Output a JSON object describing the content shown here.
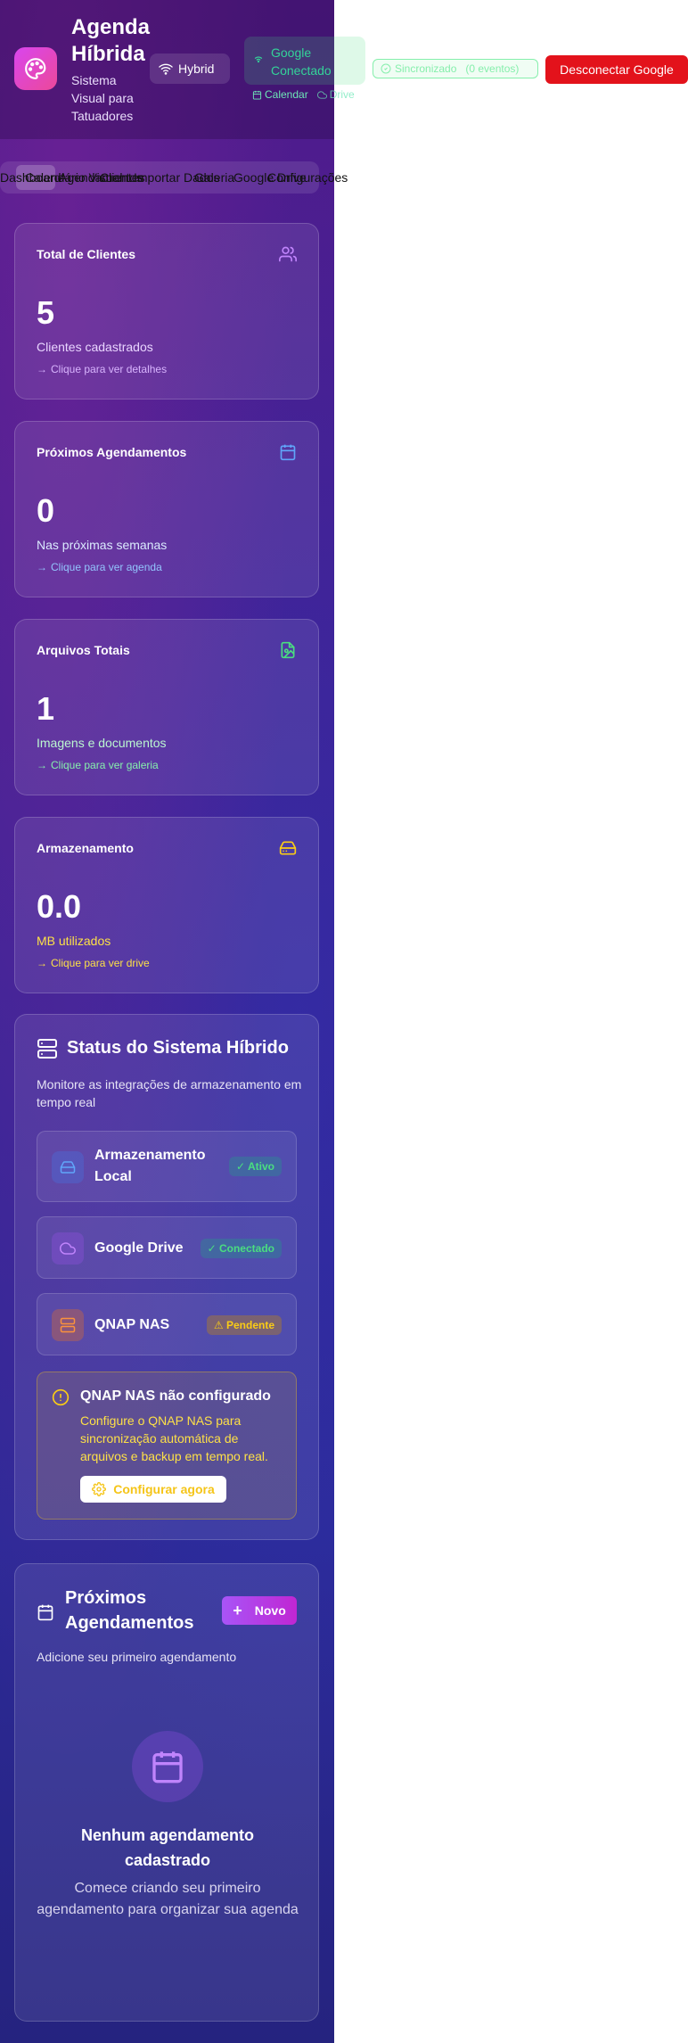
{
  "header": {
    "title": "Agenda Híbrida",
    "subtitle": "Sistema Visual para Tatuadores",
    "mode_label": "Hybrid",
    "google_status": "Google Conectado",
    "calendar_link": "Calendar",
    "drive_link": "Drive",
    "sync_status": "Sincronizado",
    "sync_events": "(0 eventos)",
    "disconnect_label": "Desconectar Google"
  },
  "tabs": [
    {
      "label": "Dashboard"
    },
    {
      "label": "Calendário Visual"
    },
    {
      "label": "Agendamentos"
    },
    {
      "label": "Clientes"
    },
    {
      "label": "Importar Dados"
    },
    {
      "label": "Galeria"
    },
    {
      "label": "Google Drive"
    },
    {
      "label": "Configurações"
    }
  ],
  "stats": [
    {
      "label": "Total de Clientes",
      "value": "5",
      "desc": "Clientes cadastrados",
      "link": "Clique para ver detalhes",
      "icon": "users-icon",
      "color": "#c084fc"
    },
    {
      "label": "Próximos Agendamentos",
      "value": "0",
      "desc": "Nas próximas semanas",
      "link": "Clique para ver agenda",
      "icon": "calendar-icon",
      "color": "#60a5fa"
    },
    {
      "label": "Arquivos Totais",
      "value": "1",
      "desc": "Imagens e documentos",
      "link": "Clique para ver galeria",
      "icon": "file-image-icon",
      "color": "#4ade80"
    },
    {
      "label": "Armazenamento",
      "value": "0.0",
      "desc": "MB utilizados",
      "link": "Clique para ver drive",
      "icon": "hard-drive-icon",
      "color": "#facc15"
    }
  ],
  "status": {
    "title": "Status do Sistema Híbrido",
    "subtitle": "Monitore as integrações de armazenamento em tempo real",
    "services": [
      {
        "name": "Armazenamento Local",
        "badge": "✓ Ativo",
        "icon": "hard-drive-icon"
      },
      {
        "name": "Google Drive",
        "badge": "✓ Conectado",
        "icon": "cloud-icon"
      },
      {
        "name": "QNAP NAS",
        "badge": "⚠ Pendente",
        "icon": "server-icon"
      }
    ],
    "warning_title": "QNAP NAS não configurado",
    "warning_text": "Configure o QNAP NAS para sincronização automática de arquivos e backup em tempo real.",
    "configure_label": "Configurar agora"
  },
  "appointments": {
    "title": "Próximos Agendamentos",
    "new_label": "Novo",
    "subtitle": "Adicione seu primeiro agendamento",
    "empty_title": "Nenhum agendamento cadastrado",
    "empty_text": "Comece criando seu primeiro agendamento para organizar sua agenda"
  }
}
